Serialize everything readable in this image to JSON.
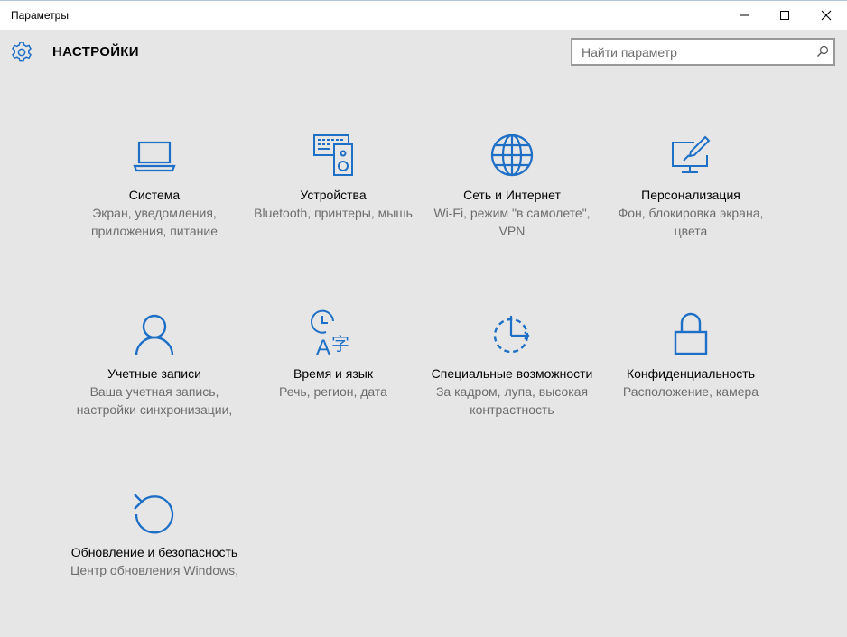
{
  "window": {
    "title": "Параметры",
    "controls": {
      "minimize": "minimize-icon",
      "maximize": "maximize-icon",
      "close": "close-icon"
    }
  },
  "header": {
    "title": "НАСТРОЙКИ",
    "icon": "gear-icon"
  },
  "search": {
    "placeholder": "Найти параметр",
    "value": "",
    "icon": "search-icon"
  },
  "accent_color": "#1e6fc6",
  "tiles": [
    {
      "title": "Система",
      "description": "Экран, уведомления, приложения, питание",
      "icon": "laptop-icon"
    },
    {
      "title": "Устройства",
      "description": "Bluetooth, принтеры, мышь",
      "icon": "devices-icon"
    },
    {
      "title": "Сеть и Интернет",
      "description": "Wi-Fi, режим \"в самолете\", VPN",
      "icon": "globe-icon"
    },
    {
      "title": "Персонализация",
      "description": "Фон, блокировка экрана, цвета",
      "icon": "personalization-icon"
    },
    {
      "title": "Учетные записи",
      "description": "Ваша учетная запись, настройки синхронизации,",
      "icon": "user-icon"
    },
    {
      "title": "Время и язык",
      "description": "Речь, регион, дата",
      "icon": "time-language-icon"
    },
    {
      "title": "Специальные возможности",
      "description": "За кадром, лупа, высокая контрастность",
      "icon": "accessibility-icon"
    },
    {
      "title": "Конфиденциальность",
      "description": "Расположение, камера",
      "icon": "lock-icon"
    },
    {
      "title": "Обновление и безопасность",
      "description": "Центр обновления Windows,",
      "icon": "update-icon"
    }
  ]
}
